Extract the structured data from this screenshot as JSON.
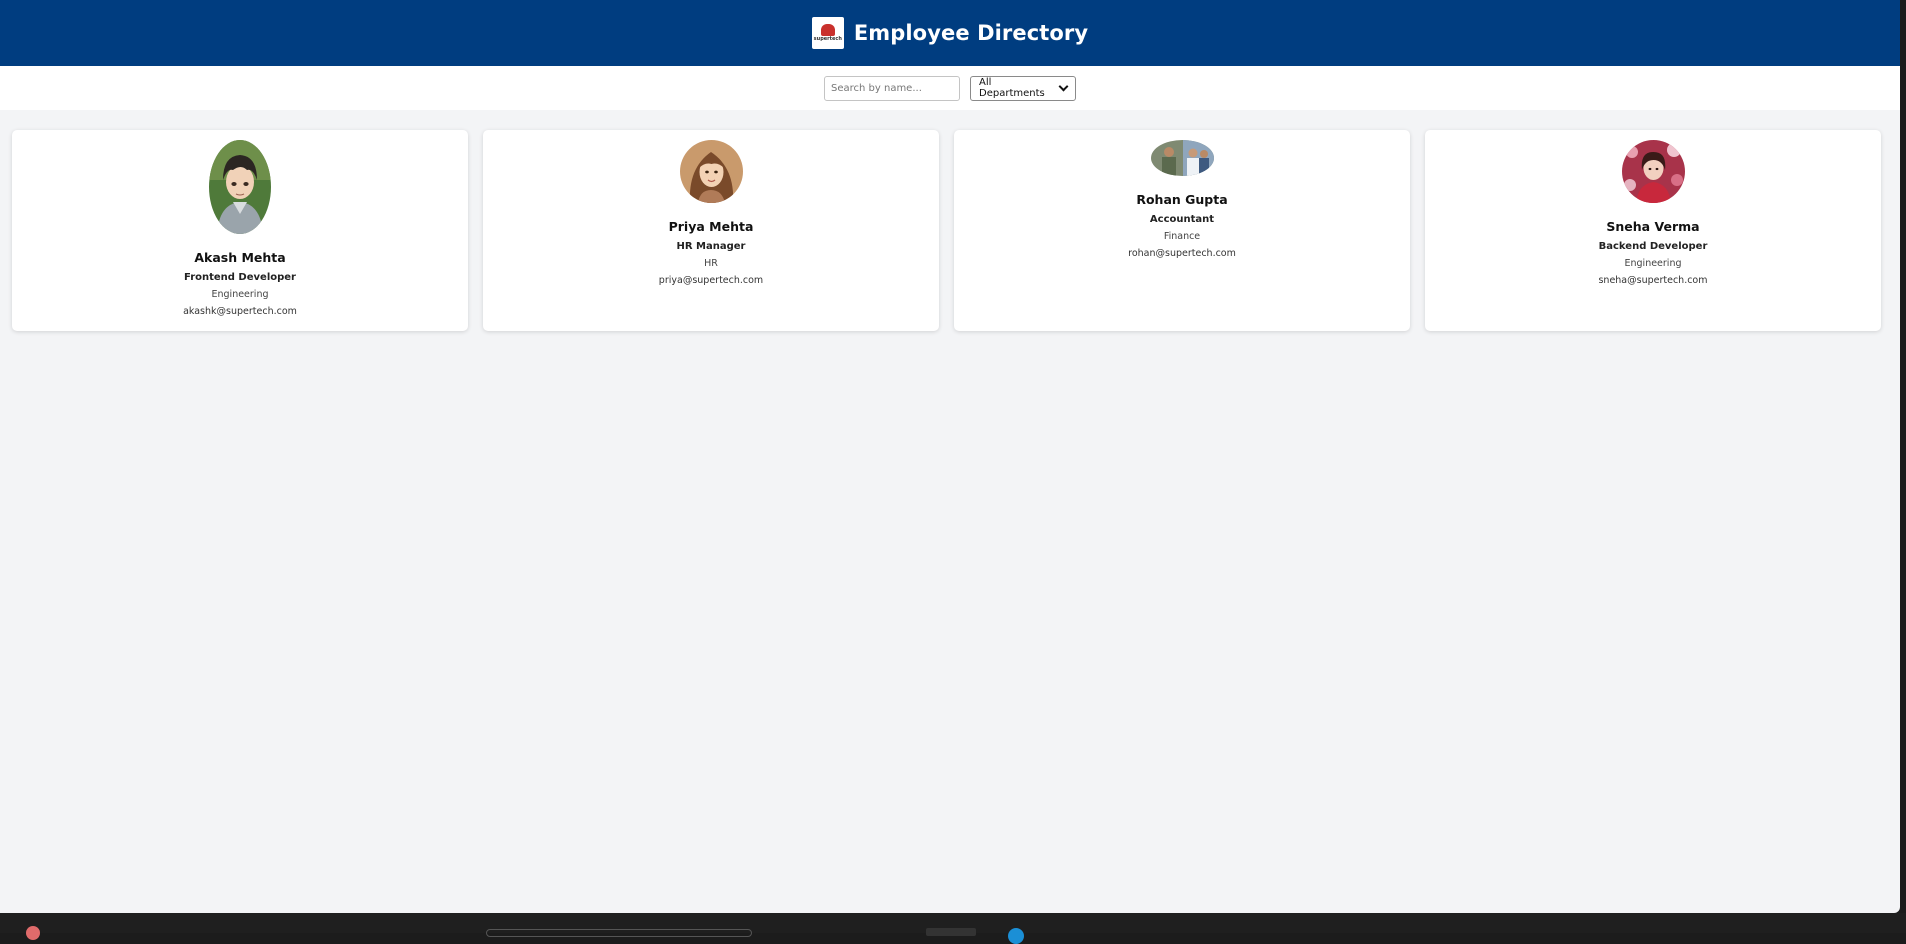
{
  "header": {
    "logo_text": "supertech",
    "title": "Employee Directory",
    "background": "#003d80"
  },
  "toolbar": {
    "search_placeholder": "Search by name...",
    "search_value": "",
    "department_selected": "All Departments"
  },
  "employees": [
    {
      "name": "Akash Mehta",
      "role": "Frontend Developer",
      "department": "Engineering",
      "email": "akashk@supertech.com",
      "avatar": "anime-boy-portrait"
    },
    {
      "name": "Priya Mehta",
      "role": "HR Manager",
      "department": "HR",
      "email": "priya@supertech.com",
      "avatar": "cartoon-woman-portrait"
    },
    {
      "name": "Rohan Gupta",
      "role": "Accountant",
      "department": "Finance",
      "email": "rohan@supertech.com",
      "avatar": "group-photo"
    },
    {
      "name": "Sneha Verma",
      "role": "Backend Developer",
      "department": "Engineering",
      "email": "sneha@supertech.com",
      "avatar": "floral-portrait"
    }
  ]
}
